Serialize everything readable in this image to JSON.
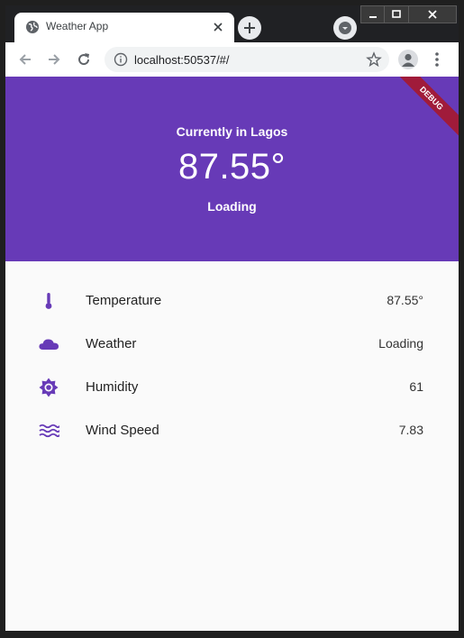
{
  "browser": {
    "tab_title": "Weather App",
    "url": "localhost:50537/#/"
  },
  "app": {
    "header": {
      "subtitle": "Currently in Lagos",
      "temperature": "87.55°",
      "status": "Loading"
    },
    "debug_banner": "DEBUG",
    "accent_color": "#673ab7",
    "rows": [
      {
        "icon": "thermometer-icon",
        "label": "Temperature",
        "value": "87.55°"
      },
      {
        "icon": "cloud-icon",
        "label": "Weather",
        "value": "Loading"
      },
      {
        "icon": "sun-icon",
        "label": "Humidity",
        "value": "61"
      },
      {
        "icon": "wind-icon",
        "label": "Wind Speed",
        "value": "7.83"
      }
    ]
  }
}
